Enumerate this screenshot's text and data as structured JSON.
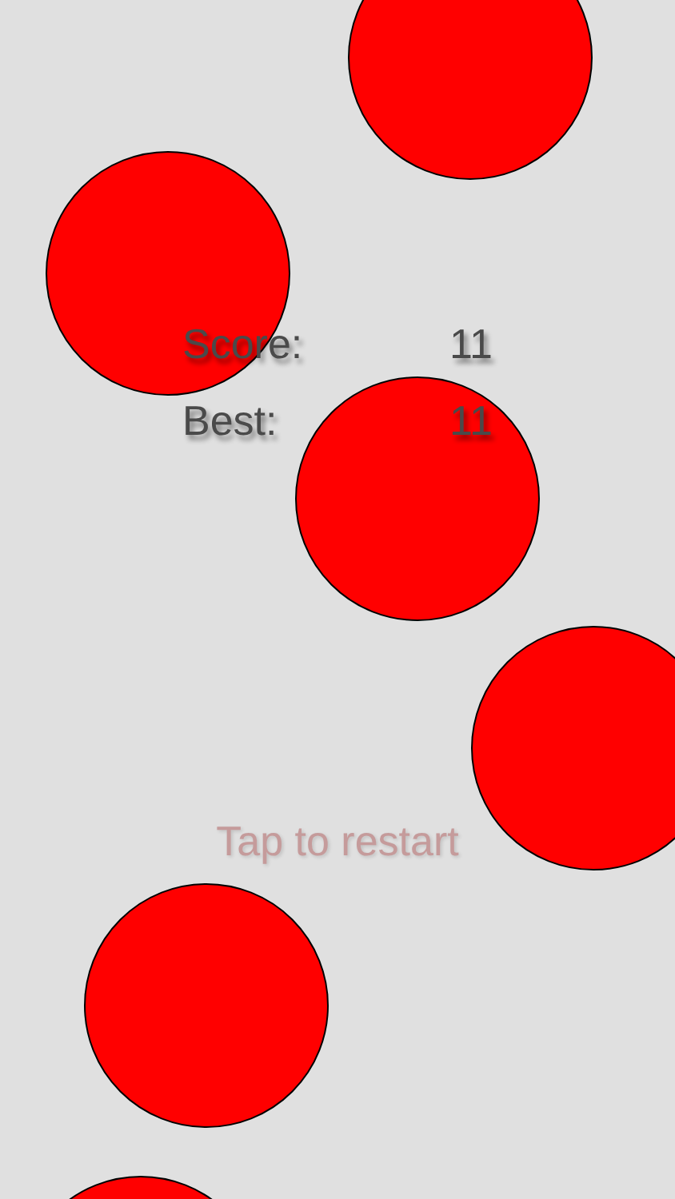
{
  "stats": [
    {
      "label": "Score:",
      "value": "11"
    },
    {
      "label": "Best:",
      "value": "11"
    }
  ],
  "prompt": "Tap to restart"
}
